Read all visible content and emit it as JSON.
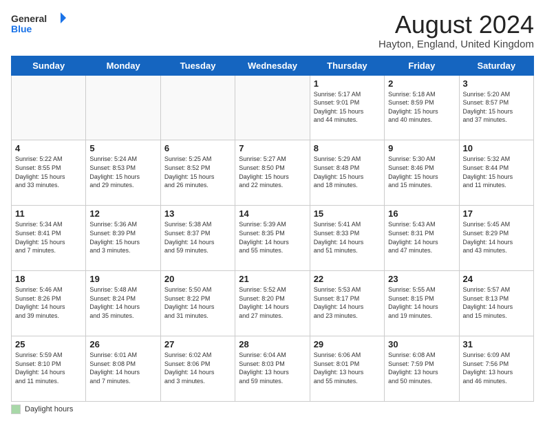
{
  "logo": {
    "line1": "General",
    "line2": "Blue"
  },
  "title": "August 2024",
  "location": "Hayton, England, United Kingdom",
  "days_of_week": [
    "Sunday",
    "Monday",
    "Tuesday",
    "Wednesday",
    "Thursday",
    "Friday",
    "Saturday"
  ],
  "footer": {
    "box_label": "Daylight hours"
  },
  "weeks": [
    [
      {
        "day": "",
        "info": ""
      },
      {
        "day": "",
        "info": ""
      },
      {
        "day": "",
        "info": ""
      },
      {
        "day": "",
        "info": ""
      },
      {
        "day": "1",
        "info": "Sunrise: 5:17 AM\nSunset: 9:01 PM\nDaylight: 15 hours\nand 44 minutes."
      },
      {
        "day": "2",
        "info": "Sunrise: 5:18 AM\nSunset: 8:59 PM\nDaylight: 15 hours\nand 40 minutes."
      },
      {
        "day": "3",
        "info": "Sunrise: 5:20 AM\nSunset: 8:57 PM\nDaylight: 15 hours\nand 37 minutes."
      }
    ],
    [
      {
        "day": "4",
        "info": "Sunrise: 5:22 AM\nSunset: 8:55 PM\nDaylight: 15 hours\nand 33 minutes."
      },
      {
        "day": "5",
        "info": "Sunrise: 5:24 AM\nSunset: 8:53 PM\nDaylight: 15 hours\nand 29 minutes."
      },
      {
        "day": "6",
        "info": "Sunrise: 5:25 AM\nSunset: 8:52 PM\nDaylight: 15 hours\nand 26 minutes."
      },
      {
        "day": "7",
        "info": "Sunrise: 5:27 AM\nSunset: 8:50 PM\nDaylight: 15 hours\nand 22 minutes."
      },
      {
        "day": "8",
        "info": "Sunrise: 5:29 AM\nSunset: 8:48 PM\nDaylight: 15 hours\nand 18 minutes."
      },
      {
        "day": "9",
        "info": "Sunrise: 5:30 AM\nSunset: 8:46 PM\nDaylight: 15 hours\nand 15 minutes."
      },
      {
        "day": "10",
        "info": "Sunrise: 5:32 AM\nSunset: 8:44 PM\nDaylight: 15 hours\nand 11 minutes."
      }
    ],
    [
      {
        "day": "11",
        "info": "Sunrise: 5:34 AM\nSunset: 8:41 PM\nDaylight: 15 hours\nand 7 minutes."
      },
      {
        "day": "12",
        "info": "Sunrise: 5:36 AM\nSunset: 8:39 PM\nDaylight: 15 hours\nand 3 minutes."
      },
      {
        "day": "13",
        "info": "Sunrise: 5:38 AM\nSunset: 8:37 PM\nDaylight: 14 hours\nand 59 minutes."
      },
      {
        "day": "14",
        "info": "Sunrise: 5:39 AM\nSunset: 8:35 PM\nDaylight: 14 hours\nand 55 minutes."
      },
      {
        "day": "15",
        "info": "Sunrise: 5:41 AM\nSunset: 8:33 PM\nDaylight: 14 hours\nand 51 minutes."
      },
      {
        "day": "16",
        "info": "Sunrise: 5:43 AM\nSunset: 8:31 PM\nDaylight: 14 hours\nand 47 minutes."
      },
      {
        "day": "17",
        "info": "Sunrise: 5:45 AM\nSunset: 8:29 PM\nDaylight: 14 hours\nand 43 minutes."
      }
    ],
    [
      {
        "day": "18",
        "info": "Sunrise: 5:46 AM\nSunset: 8:26 PM\nDaylight: 14 hours\nand 39 minutes."
      },
      {
        "day": "19",
        "info": "Sunrise: 5:48 AM\nSunset: 8:24 PM\nDaylight: 14 hours\nand 35 minutes."
      },
      {
        "day": "20",
        "info": "Sunrise: 5:50 AM\nSunset: 8:22 PM\nDaylight: 14 hours\nand 31 minutes."
      },
      {
        "day": "21",
        "info": "Sunrise: 5:52 AM\nSunset: 8:20 PM\nDaylight: 14 hours\nand 27 minutes."
      },
      {
        "day": "22",
        "info": "Sunrise: 5:53 AM\nSunset: 8:17 PM\nDaylight: 14 hours\nand 23 minutes."
      },
      {
        "day": "23",
        "info": "Sunrise: 5:55 AM\nSunset: 8:15 PM\nDaylight: 14 hours\nand 19 minutes."
      },
      {
        "day": "24",
        "info": "Sunrise: 5:57 AM\nSunset: 8:13 PM\nDaylight: 14 hours\nand 15 minutes."
      }
    ],
    [
      {
        "day": "25",
        "info": "Sunrise: 5:59 AM\nSunset: 8:10 PM\nDaylight: 14 hours\nand 11 minutes."
      },
      {
        "day": "26",
        "info": "Sunrise: 6:01 AM\nSunset: 8:08 PM\nDaylight: 14 hours\nand 7 minutes."
      },
      {
        "day": "27",
        "info": "Sunrise: 6:02 AM\nSunset: 8:06 PM\nDaylight: 14 hours\nand 3 minutes."
      },
      {
        "day": "28",
        "info": "Sunrise: 6:04 AM\nSunset: 8:03 PM\nDaylight: 13 hours\nand 59 minutes."
      },
      {
        "day": "29",
        "info": "Sunrise: 6:06 AM\nSunset: 8:01 PM\nDaylight: 13 hours\nand 55 minutes."
      },
      {
        "day": "30",
        "info": "Sunrise: 6:08 AM\nSunset: 7:59 PM\nDaylight: 13 hours\nand 50 minutes."
      },
      {
        "day": "31",
        "info": "Sunrise: 6:09 AM\nSunset: 7:56 PM\nDaylight: 13 hours\nand 46 minutes."
      }
    ]
  ]
}
